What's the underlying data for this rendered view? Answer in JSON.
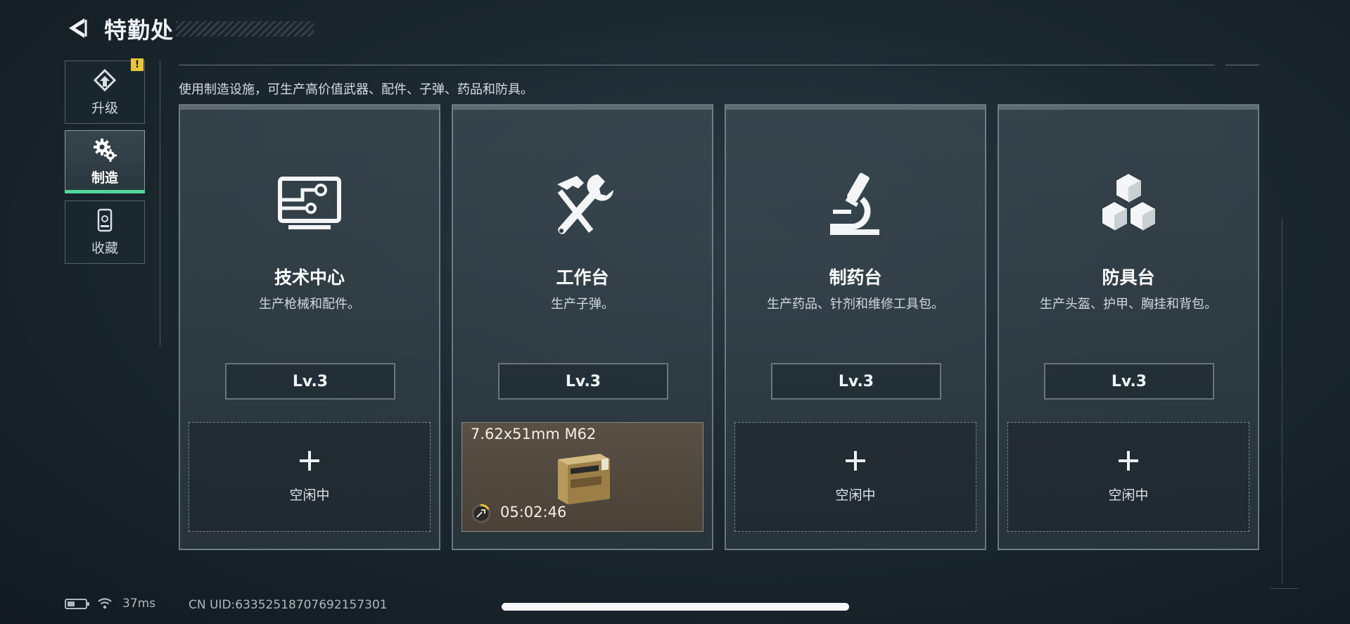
{
  "header": {
    "title": "特勤处"
  },
  "sidebar": {
    "items": [
      {
        "label": "升级",
        "icon": "upgrade-icon",
        "alert": "!"
      },
      {
        "label": "制造",
        "icon": "gears-icon",
        "active": true
      },
      {
        "label": "收藏",
        "icon": "collection-icon"
      }
    ]
  },
  "description": "使用制造设施，可生产高价值武器、配件、子弹、药品和防具。",
  "cards": [
    {
      "name": "技术中心",
      "sub": "生产枪械和配件。",
      "level": "Lv.3",
      "icon": "computer-icon",
      "slot": {
        "plus": "+",
        "status": "空闲中"
      }
    },
    {
      "name": "工作台",
      "sub": "生产子弹。",
      "level": "Lv.3",
      "icon": "hammer-wrench-icon",
      "slot": {
        "item": "7.62x51mm M62",
        "timer": "05:02:46",
        "progress": 0.15
      }
    },
    {
      "name": "制药台",
      "sub": "生产药品、针剂和维修工具包。",
      "level": "Lv.3",
      "icon": "microscope-icon",
      "slot": {
        "plus": "+",
        "status": "空闲中"
      }
    },
    {
      "name": "防具台",
      "sub": "生产头盔、护甲、胸挂和背包。",
      "level": "Lv.3",
      "icon": "cubes-icon",
      "slot": {
        "plus": "+",
        "status": "空闲中"
      }
    }
  ],
  "status_bar": {
    "ping": "37ms",
    "uid": "CN UID:63352518707692157301"
  },
  "colors": {
    "accent": "#52d69a",
    "alert": "#e9c73a",
    "timer": "#e8c23a"
  }
}
